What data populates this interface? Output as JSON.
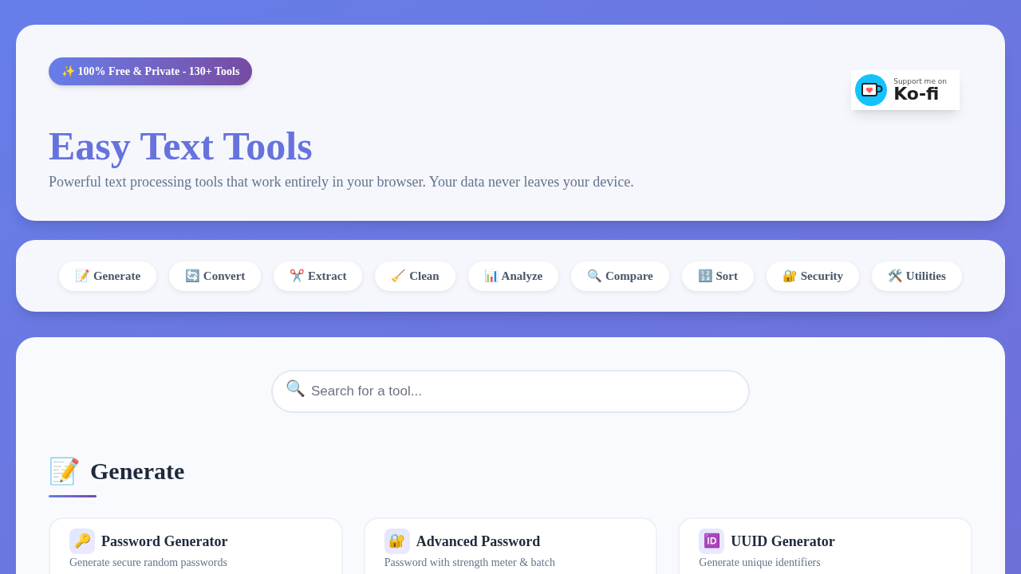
{
  "header": {
    "badge": "✨ 100% Free & Private - 130+ Tools",
    "kofi": {
      "small": "Support me on",
      "brand": "Ko-fi"
    },
    "title": "Easy Text Tools",
    "subtitle": "Powerful text processing tools that work entirely in your browser. Your data never leaves your device."
  },
  "categories": [
    {
      "label": "📝 Generate"
    },
    {
      "label": "🔄 Convert"
    },
    {
      "label": "✂️ Extract"
    },
    {
      "label": "🧹 Clean"
    },
    {
      "label": "📊 Analyze"
    },
    {
      "label": "🔍 Compare"
    },
    {
      "label": "🔢 Sort"
    },
    {
      "label": "🔐 Security"
    },
    {
      "label": "🛠️ Utilities"
    }
  ],
  "search": {
    "icon": "🔍",
    "placeholder": "Search for a tool..."
  },
  "section": {
    "icon": "📝",
    "title": "Generate",
    "tools": [
      {
        "icon": "🔑",
        "name": "Password Generator",
        "description": "Generate secure random passwords"
      },
      {
        "icon": "🔐",
        "name": "Advanced Password",
        "description": "Password with strength meter & batch"
      },
      {
        "icon": "🆔",
        "name": "UUID Generator",
        "description": "Generate unique identifiers"
      }
    ]
  }
}
